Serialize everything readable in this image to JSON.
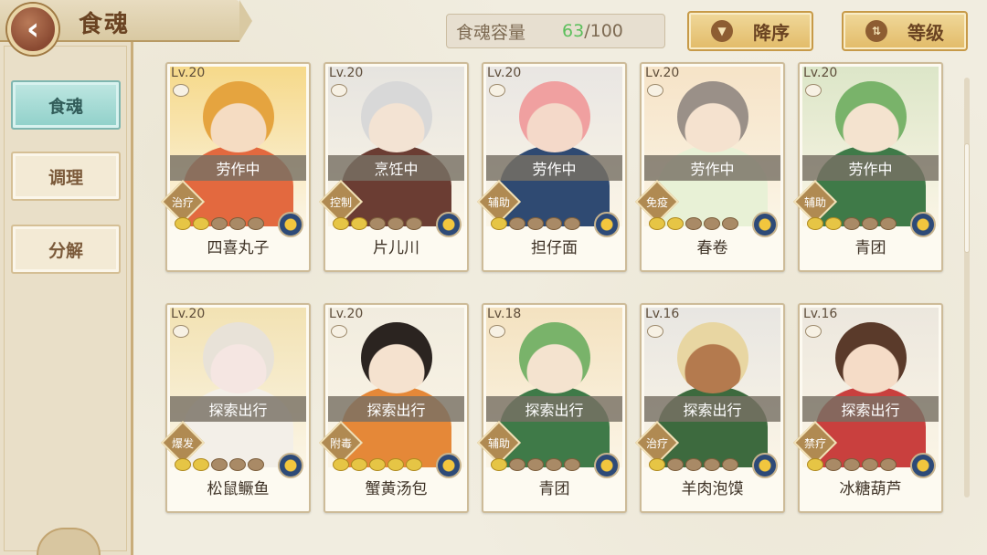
{
  "header": {
    "back_icon": "chevron-left-icon",
    "title": "食魂"
  },
  "capacity": {
    "label": "食魂容量",
    "current": "63",
    "max": "/100"
  },
  "sort": {
    "order_label": "降序",
    "order_icon": "triangle-down-icon",
    "level_label": "等级",
    "level_icon": "swap-arrows-icon"
  },
  "sidebar": {
    "items": [
      {
        "label": "食魂",
        "active": true
      },
      {
        "label": "调理",
        "active": false
      },
      {
        "label": "分解",
        "active": false
      }
    ]
  },
  "cards": [
    {
      "level": "Lv.20",
      "status": "劳作中",
      "role": "治疗",
      "stars_on": 2,
      "name": "四喜丸子",
      "bg": "#f6d98a",
      "skin": "#f5dcc2",
      "hair": "#e5a43f",
      "cloth": "#e3693f"
    },
    {
      "level": "Lv.20",
      "status": "烹饪中",
      "role": "控制",
      "stars_on": 2,
      "name": "片儿川",
      "bg": "#e6e4e0",
      "skin": "#f3e3d3",
      "hair": "#d8d8d8",
      "cloth": "#6b3d33"
    },
    {
      "level": "Lv.20",
      "status": "劳作中",
      "role": "辅助",
      "stars_on": 1,
      "name": "担仔面",
      "bg": "#e9e6e3",
      "skin": "#f4d9c9",
      "hair": "#f0a0a0",
      "cloth": "#2f4a72"
    },
    {
      "level": "Lv.20",
      "status": "劳作中",
      "role": "免疫",
      "stars_on": 2,
      "name": "春卷",
      "bg": "#f6e3c7",
      "skin": "#f5e2cf",
      "hair": "#9a9088",
      "cloth": "#e8f1d6"
    },
    {
      "level": "Lv.20",
      "status": "劳作中",
      "role": "辅助",
      "stars_on": 2,
      "name": "青团",
      "bg": "#dce6c8",
      "skin": "#f4e3cf",
      "hair": "#79b36a",
      "cloth": "#3f7a48"
    },
    {
      "level": "Lv.20",
      "status": "探索出行",
      "role": "爆发",
      "stars_on": 2,
      "name": "松鼠鳜鱼",
      "bg": "#f2e2b3",
      "skin": "#f5e6e2",
      "hair": "#e8e2d8",
      "cloth": "#f3efe8"
    },
    {
      "level": "Lv.20",
      "status": "探索出行",
      "role": "附毒",
      "stars_on": 5,
      "name": "蟹黄汤包",
      "bg": "#f1ecdf",
      "skin": "#f5e2cf",
      "hair": "#2b2420",
      "cloth": "#e58838"
    },
    {
      "level": "Lv.18",
      "status": "探索出行",
      "role": "辅助",
      "stars_on": 1,
      "name": "青团",
      "bg": "#f4e2c0",
      "skin": "#f4e3cf",
      "hair": "#79b36a",
      "cloth": "#3f7a48"
    },
    {
      "level": "Lv.16",
      "status": "探索出行",
      "role": "治疗",
      "stars_on": 1,
      "name": "羊肉泡馍",
      "bg": "#e8e6e2",
      "skin": "#b47a4e",
      "hair": "#e8d6a2",
      "cloth": "#3d6a3e"
    },
    {
      "level": "Lv.16",
      "status": "探索出行",
      "role": "禁疗",
      "stars_on": 1,
      "name": "冰糖葫芦",
      "bg": "#ece7de",
      "skin": "#f5dcc7",
      "hair": "#5a3a2a",
      "cloth": "#c9403e"
    }
  ],
  "element_icon": "flower-element-icon",
  "bowl_icon": "bowl-icon"
}
